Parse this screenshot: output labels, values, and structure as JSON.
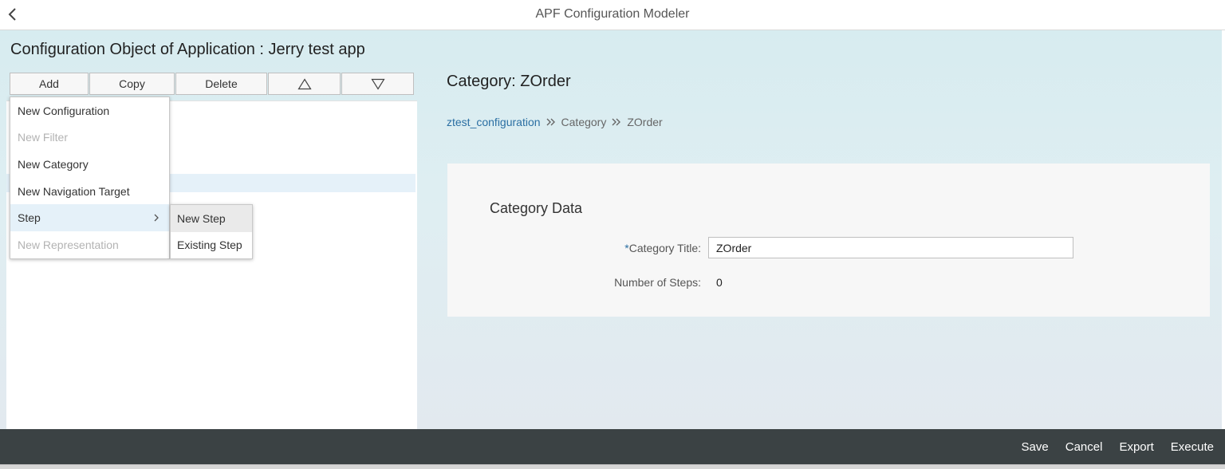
{
  "header": {
    "title": "APF Configuration Modeler",
    "back_icon": "chevron-left-icon"
  },
  "page": {
    "title": "Configuration Object of Application : Jerry test app"
  },
  "toolbar": {
    "add_label": "Add",
    "copy_label": "Copy",
    "delete_label": "Delete",
    "move_up_icon": "triangle-up-icon",
    "move_down_icon": "triangle-down-icon"
  },
  "add_menu": {
    "items": [
      {
        "label": "New Configuration",
        "enabled": true
      },
      {
        "label": "New Filter",
        "enabled": false
      },
      {
        "label": "New Category",
        "enabled": true
      },
      {
        "label": "New Navigation Target",
        "enabled": true
      },
      {
        "label": "Step",
        "enabled": true,
        "has_submenu": true
      },
      {
        "label": "New Representation",
        "enabled": false
      }
    ],
    "submenu": {
      "items": [
        {
          "label": "New Step"
        },
        {
          "label": "Existing Step"
        }
      ]
    }
  },
  "detail": {
    "title": "Category: ZOrder",
    "breadcrumb": {
      "link": "ztest_configuration",
      "item1": "Category",
      "item2": "ZOrder"
    },
    "form": {
      "heading": "Category Data",
      "required_marker": "*",
      "title_label": "Category Title:",
      "title_value": "ZOrder",
      "steps_label": "Number of Steps:",
      "steps_value": "0"
    }
  },
  "footer": {
    "save_label": "Save",
    "cancel_label": "Cancel",
    "export_label": "Export",
    "execute_label": "Execute"
  },
  "colors": {
    "link": "#2b6fa3",
    "footer_bg": "#3b4244",
    "selection": "#e5f1f9"
  }
}
